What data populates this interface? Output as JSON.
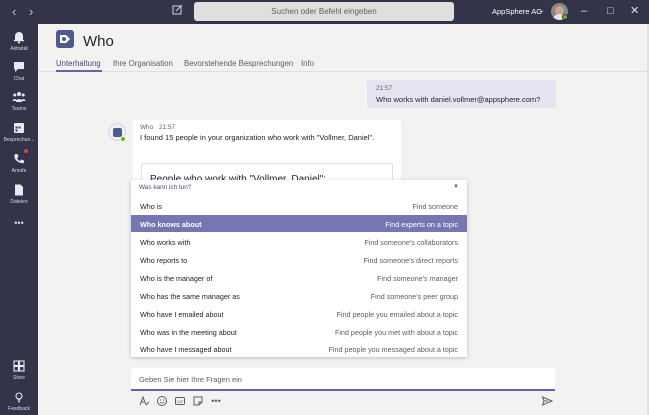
{
  "titlebar": {
    "search_placeholder": "Suchen oder Befehl eingeben",
    "org_name": "AppSphere AG"
  },
  "rail": {
    "items": [
      {
        "label": "Aktivität",
        "icon": "bell-icon"
      },
      {
        "label": "Chat",
        "icon": "chat-icon"
      },
      {
        "label": "Teams",
        "icon": "teams-icon"
      },
      {
        "label": "Besprechun...",
        "icon": "calendar-icon"
      },
      {
        "label": "Anrufe",
        "icon": "phone-icon"
      },
      {
        "label": "Dateien",
        "icon": "files-icon"
      },
      {
        "label": "•••",
        "icon": "more-icon"
      }
    ],
    "bottom_items": [
      {
        "label": "Store",
        "icon": "store-icon"
      },
      {
        "label": "Feedback",
        "icon": "feedback-icon"
      }
    ]
  },
  "header": {
    "title": "Who",
    "tabs": [
      {
        "label": "Unterhaltung",
        "active": true
      },
      {
        "label": "Ihre Organisation",
        "active": false
      },
      {
        "label": "Bevorstehende Besprechungen",
        "active": false
      },
      {
        "label": "Info",
        "active": false
      }
    ]
  },
  "chat": {
    "outgoing": {
      "time": "21:57",
      "text": "Who works with daniel.vollmer@appsphere.com?"
    },
    "incoming": {
      "sender": "Who",
      "time": "21:57",
      "text": "I found 15 people in your organization who work with \"Vollmer, Daniel\".",
      "card_title": "People who work with \"Vollmer, Daniel\":"
    }
  },
  "dropdown": {
    "header": "Was kann ich tun?",
    "items": [
      {
        "command": "Who is",
        "description": "Find someone",
        "selected": false
      },
      {
        "command": "Who knows about",
        "description": "Find experts on a topic",
        "selected": true
      },
      {
        "command": "Who works with",
        "description": "Find someone's collaborators",
        "selected": false
      },
      {
        "command": "Who reports to",
        "description": "Find someone's direct reports",
        "selected": false
      },
      {
        "command": "Who is the manager of",
        "description": "Find someone's manager",
        "selected": false
      },
      {
        "command": "Who has the same manager as",
        "description": "Find someone's peer group",
        "selected": false
      },
      {
        "command": "Who have I emailed about",
        "description": "Find people you emailed about a topic",
        "selected": false
      },
      {
        "command": "Who was in the meeting about",
        "description": "Find people you met with about a topic",
        "selected": false
      },
      {
        "command": "Who have I messaged about",
        "description": "Find people you messaged about a topic",
        "selected": false
      }
    ]
  },
  "compose": {
    "placeholder": "Geben Sie hier Ihre Fragen ein"
  },
  "colors": {
    "rail": "#33344a",
    "accent": "#6264a7",
    "selected_item": "#7577b3",
    "presence_available": "#6bb700"
  }
}
